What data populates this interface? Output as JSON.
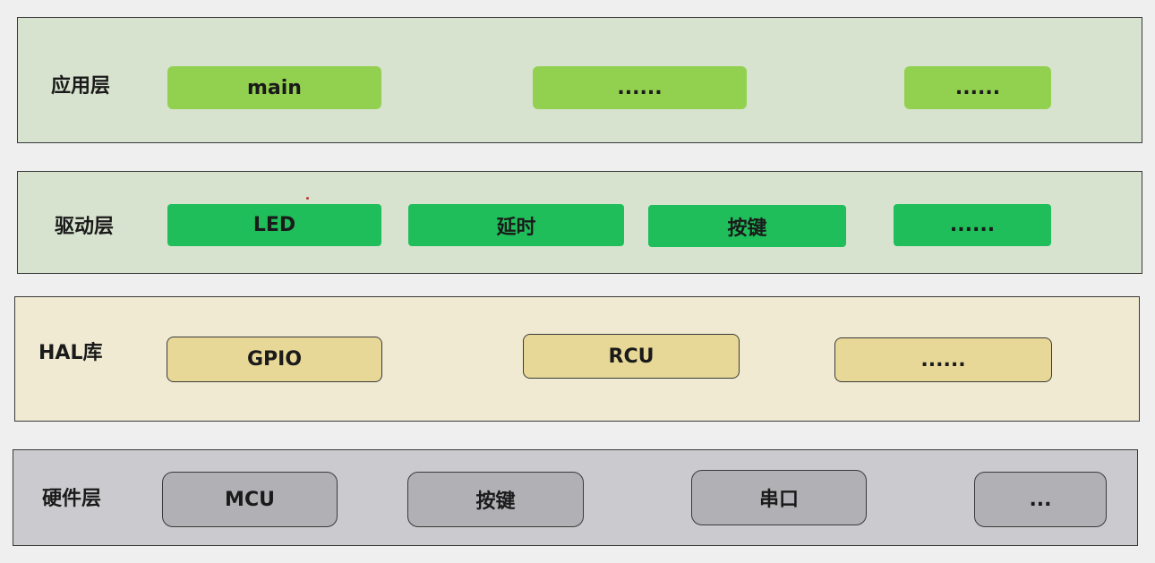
{
  "colors": {
    "page_bg": "#efeff0",
    "app_layer_bg": "#d7e3cf",
    "app_box": "#92d050",
    "driver_layer_bg": "#d7e3cf",
    "driver_box": "#1fbe5a",
    "hal_layer_bg": "#f0ead2",
    "hal_box": "#e8d897",
    "hardware_layer_bg": "#cbcbcf",
    "hardware_box": "#b1b1b5"
  },
  "layers": {
    "app": {
      "label": "应用层",
      "items": [
        "main",
        "......",
        "......"
      ]
    },
    "driver": {
      "label": "驱动层",
      "items": [
        "LED",
        "延时",
        "按键",
        "......"
      ]
    },
    "hal": {
      "label": "HAL库",
      "items": [
        "GPIO",
        "RCU",
        "......"
      ]
    },
    "hardware": {
      "label": "硬件层",
      "items": [
        "MCU",
        "按键",
        "串口",
        "..."
      ]
    }
  }
}
